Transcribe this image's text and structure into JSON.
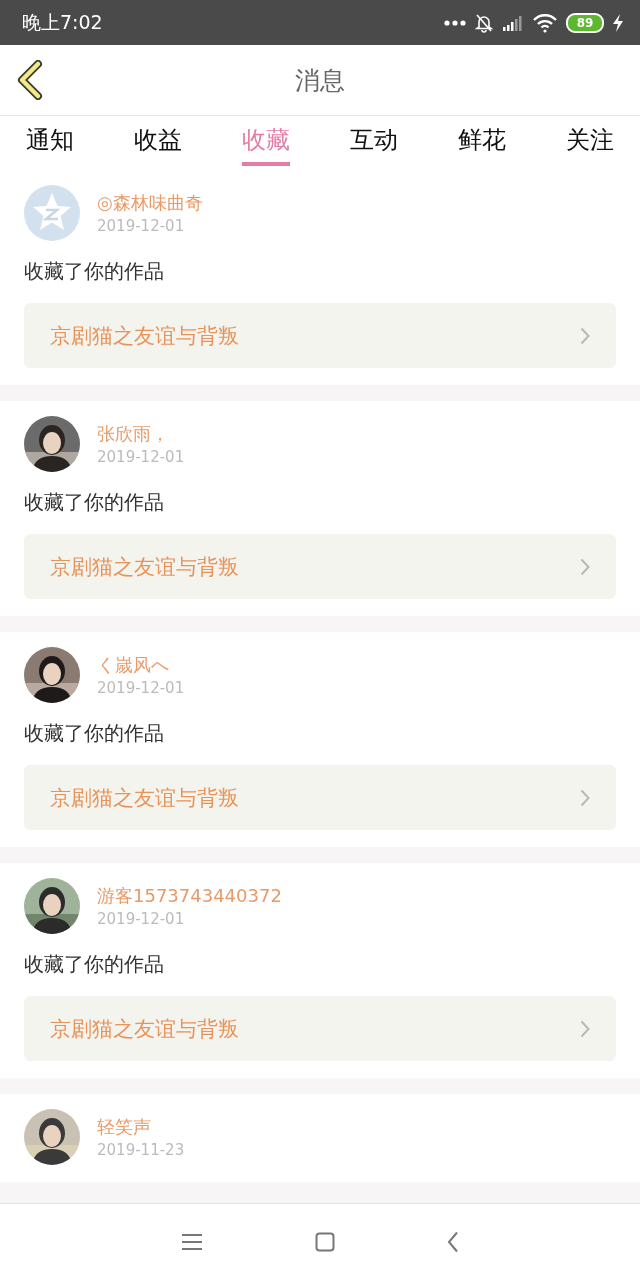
{
  "status_bar": {
    "time": "晚上7:02",
    "battery": "89"
  },
  "header": {
    "title": "消息"
  },
  "tabs": [
    {
      "label": "通知",
      "selected": false
    },
    {
      "label": "收益",
      "selected": false
    },
    {
      "label": "收藏",
      "selected": true
    },
    {
      "label": "互动",
      "selected": false
    },
    {
      "label": "鲜花",
      "selected": false
    },
    {
      "label": "关注",
      "selected": false
    }
  ],
  "messages": [
    {
      "avatar": {
        "kind": "default"
      },
      "name": "◎森林味曲奇",
      "date": "2019-12-01",
      "text": "收藏了你的作品",
      "work": "京剧猫之友谊与背叛"
    },
    {
      "name": "张欣雨，",
      "date": "2019-12-01",
      "text": "收藏了你的作品",
      "work": "京剧猫之友谊与背叛"
    },
    {
      "name": "く嵗风へ",
      "date": "2019-12-01",
      "text": "收藏了你的作品",
      "work": "京剧猫之友谊与背叛"
    },
    {
      "name": "游客1573743440372",
      "date": "2019-12-01",
      "text": "收藏了你的作品",
      "work": "京剧猫之友谊与背叛"
    },
    {
      "name": "轻笑声",
      "date": "2019-11-23"
    }
  ]
}
